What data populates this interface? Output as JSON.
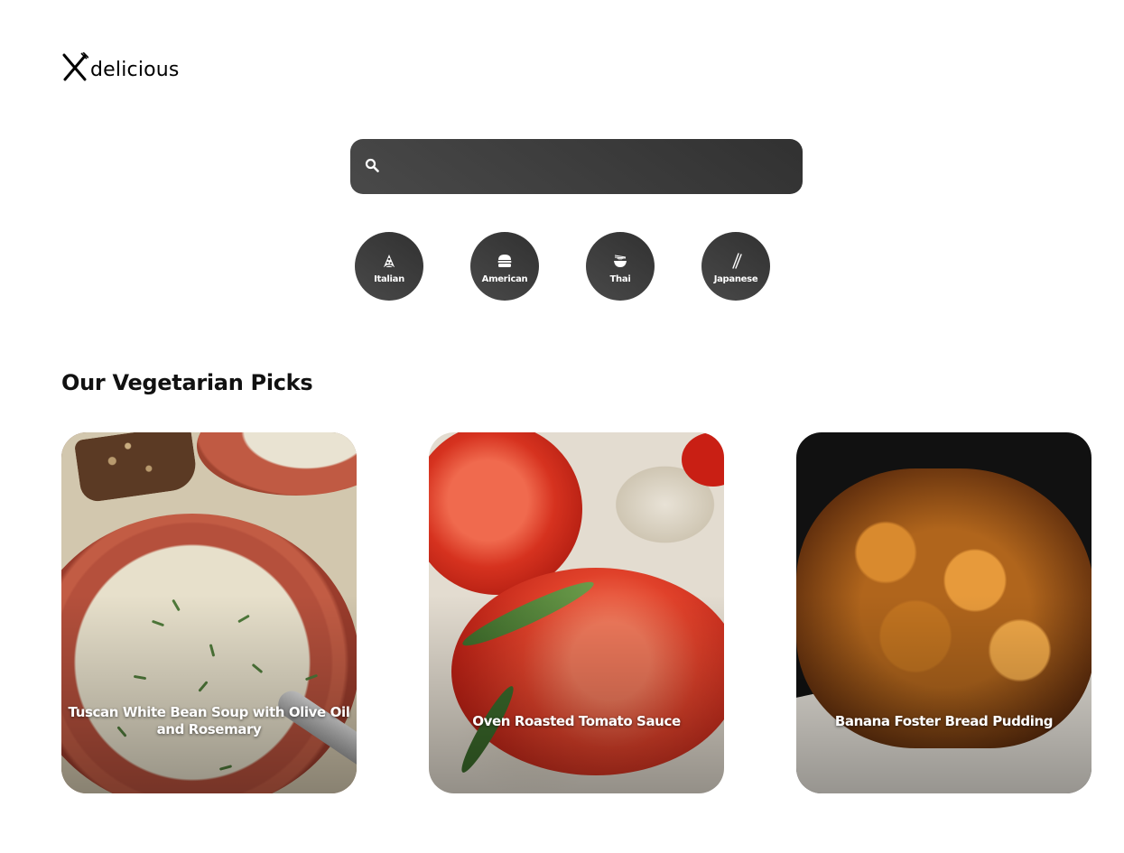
{
  "brand": {
    "name": "delicious",
    "logo_icon": "fork-knife-crossed-icon"
  },
  "search": {
    "icon": "search-icon",
    "value": "",
    "placeholder": ""
  },
  "categories": [
    {
      "label": "Italian",
      "icon": "pizza-icon"
    },
    {
      "label": "American",
      "icon": "burger-icon"
    },
    {
      "label": "Thai",
      "icon": "noodle-bowl-icon"
    },
    {
      "label": "Japanese",
      "icon": "chopsticks-icon"
    }
  ],
  "section": {
    "title": "Our Vegetarian Picks"
  },
  "recipes": [
    {
      "title": "Tuscan White Bean Soup with Olive Oil and Rosemary"
    },
    {
      "title": "Oven Roasted Tomato Sauce"
    },
    {
      "title": "Banana Foster Bread Pudding"
    }
  ],
  "colors": {
    "dark_gradient_start": "#494949",
    "dark_gradient_end": "#313131",
    "background": "#ffffff",
    "text": "#111111"
  }
}
